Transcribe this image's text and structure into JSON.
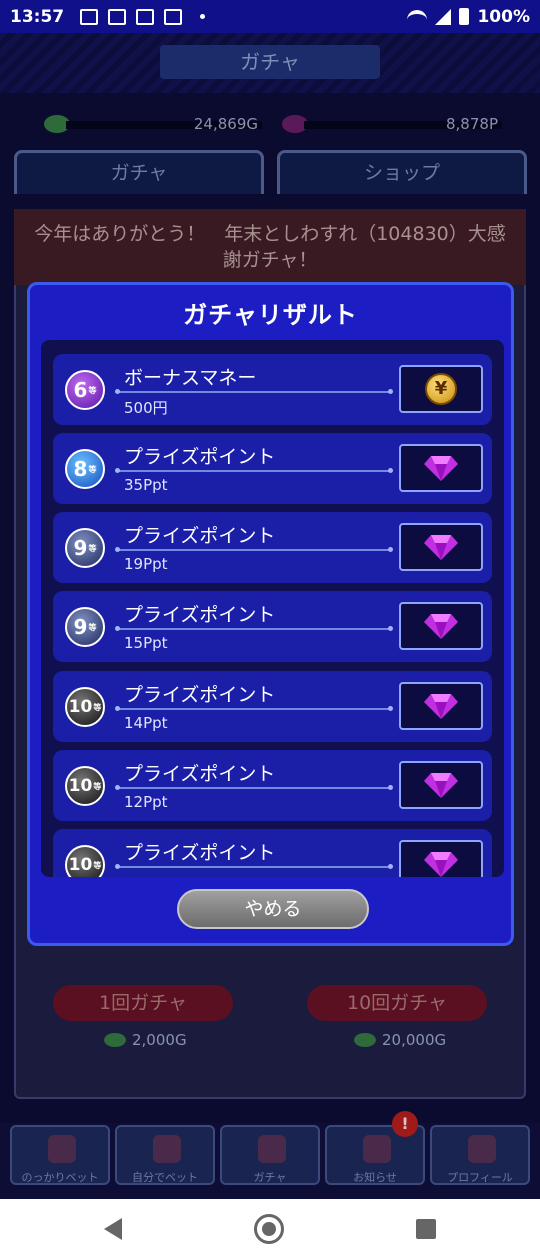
{
  "status_bar": {
    "time": "13:57",
    "battery": "100%"
  },
  "background": {
    "header_title": "ガチャ",
    "gold": "24,869G",
    "points": "8,878P",
    "tabs": [
      "ガチャ",
      "ショップ"
    ],
    "banner": "今年はありがとう！　年末としわすれ（104830）大感謝ガチャ！",
    "gacha_1_label": "1回ガチャ",
    "gacha_10_label": "10回ガチャ",
    "gacha_1_cost": "2,000G",
    "gacha_10_cost": "20,000G",
    "nav": [
      "のっかりベット",
      "自分でベット",
      "ガチャ",
      "お知らせ",
      "プロフィール"
    ],
    "notification_badge": "!"
  },
  "modal": {
    "title": "ガチャリザルト",
    "rows": [
      {
        "rank": "6",
        "rank_suffix": "等",
        "name": "ボーナスマネー",
        "value": "500円",
        "icon": "yen-coin-icon"
      },
      {
        "rank": "8",
        "rank_suffix": "等",
        "name": "プライズポイント",
        "value": "35Ppt",
        "icon": "gem-icon"
      },
      {
        "rank": "9",
        "rank_suffix": "等",
        "name": "プライズポイント",
        "value": "19Ppt",
        "icon": "gem-icon"
      },
      {
        "rank": "9",
        "rank_suffix": "等",
        "name": "プライズポイント",
        "value": "15Ppt",
        "icon": "gem-icon"
      },
      {
        "rank": "10",
        "rank_suffix": "等",
        "name": "プライズポイント",
        "value": "14Ppt",
        "icon": "gem-icon"
      },
      {
        "rank": "10",
        "rank_suffix": "等",
        "name": "プライズポイント",
        "value": "12Ppt",
        "icon": "gem-icon"
      },
      {
        "rank": "10",
        "rank_suffix": "等",
        "name": "プライズポイント",
        "value": "",
        "icon": "gem-icon"
      }
    ],
    "coin_glyph": "¥",
    "close_label": "やめる"
  },
  "colors": {
    "modal_bg": "#1c1ec4",
    "row_bg": "#1b1fa8",
    "gem": "#d040f0",
    "coin": "#f0b020"
  }
}
